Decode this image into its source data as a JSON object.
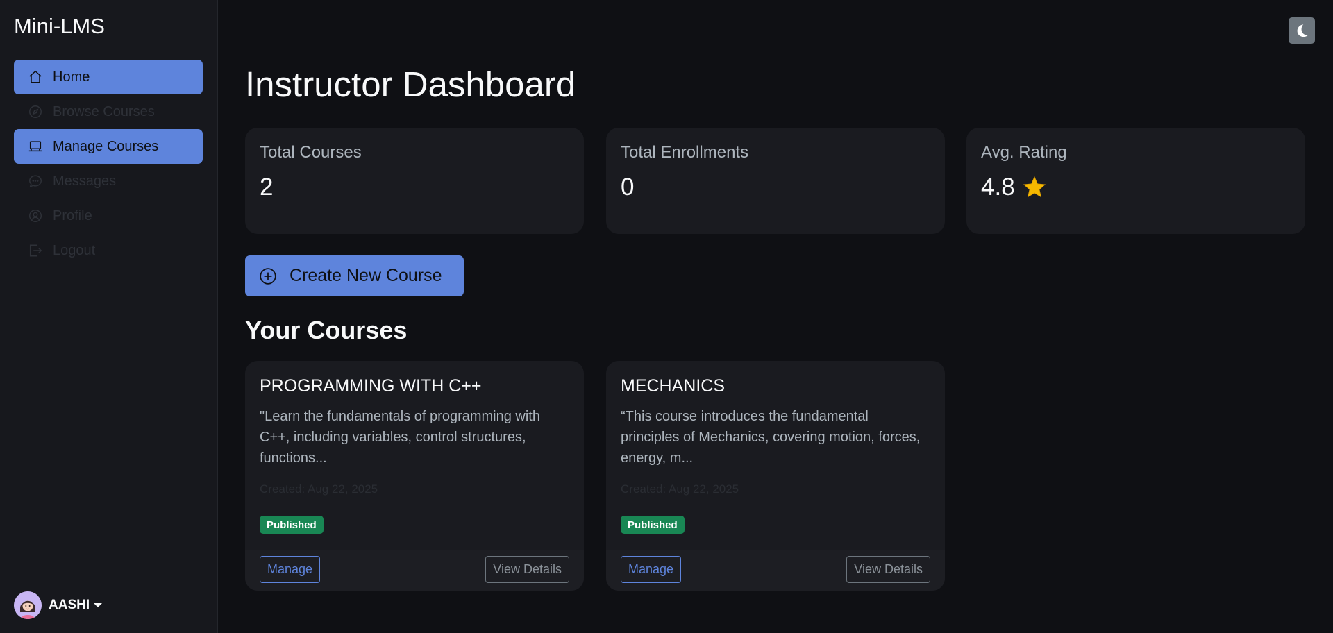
{
  "app": {
    "brand": "Mini-LMS"
  },
  "sidebar": {
    "items": [
      {
        "label": "Home",
        "icon": "home-icon",
        "active": true
      },
      {
        "label": "Browse Courses",
        "icon": "compass-icon",
        "active": false
      },
      {
        "label": "Manage Courses",
        "icon": "laptop-icon",
        "active": true
      },
      {
        "label": "Messages",
        "icon": "chat-icon",
        "active": false
      },
      {
        "label": "Profile",
        "icon": "user-circle-icon",
        "active": false
      },
      {
        "label": "Logout",
        "icon": "logout-icon",
        "active": false
      }
    ],
    "user": {
      "name": "AASHI"
    }
  },
  "header": {
    "theme_toggle_icon": "moon-icon"
  },
  "main": {
    "title": "Instructor Dashboard",
    "stats": [
      {
        "label": "Total Courses",
        "value": "2"
      },
      {
        "label": "Total Enrollments",
        "value": "0"
      },
      {
        "label": "Avg. Rating",
        "value": "4.8",
        "icon": "star-icon"
      }
    ],
    "create_button": "Create New Course",
    "section_title": "Your Courses",
    "courses": [
      {
        "title": "PROGRAMMING WITH C++",
        "description": "\"Learn the fundamentals of programming with C++, including variables, control structures, functions...",
        "created": "Created: Aug 22, 2025",
        "status": "Published",
        "manage_label": "Manage",
        "details_label": "View Details"
      },
      {
        "title": "MECHANICS",
        "description": "“This course introduces the fundamental principles of Mechanics, covering motion, forces, energy, m...",
        "created": "Created: Aug 22, 2025",
        "status": "Published",
        "manage_label": "Manage",
        "details_label": "View Details"
      }
    ]
  },
  "colors": {
    "accent": "#5e84dc",
    "background": "#0f1014",
    "card": "#1a1b20",
    "published": "#198754",
    "star": "#f5b800"
  }
}
